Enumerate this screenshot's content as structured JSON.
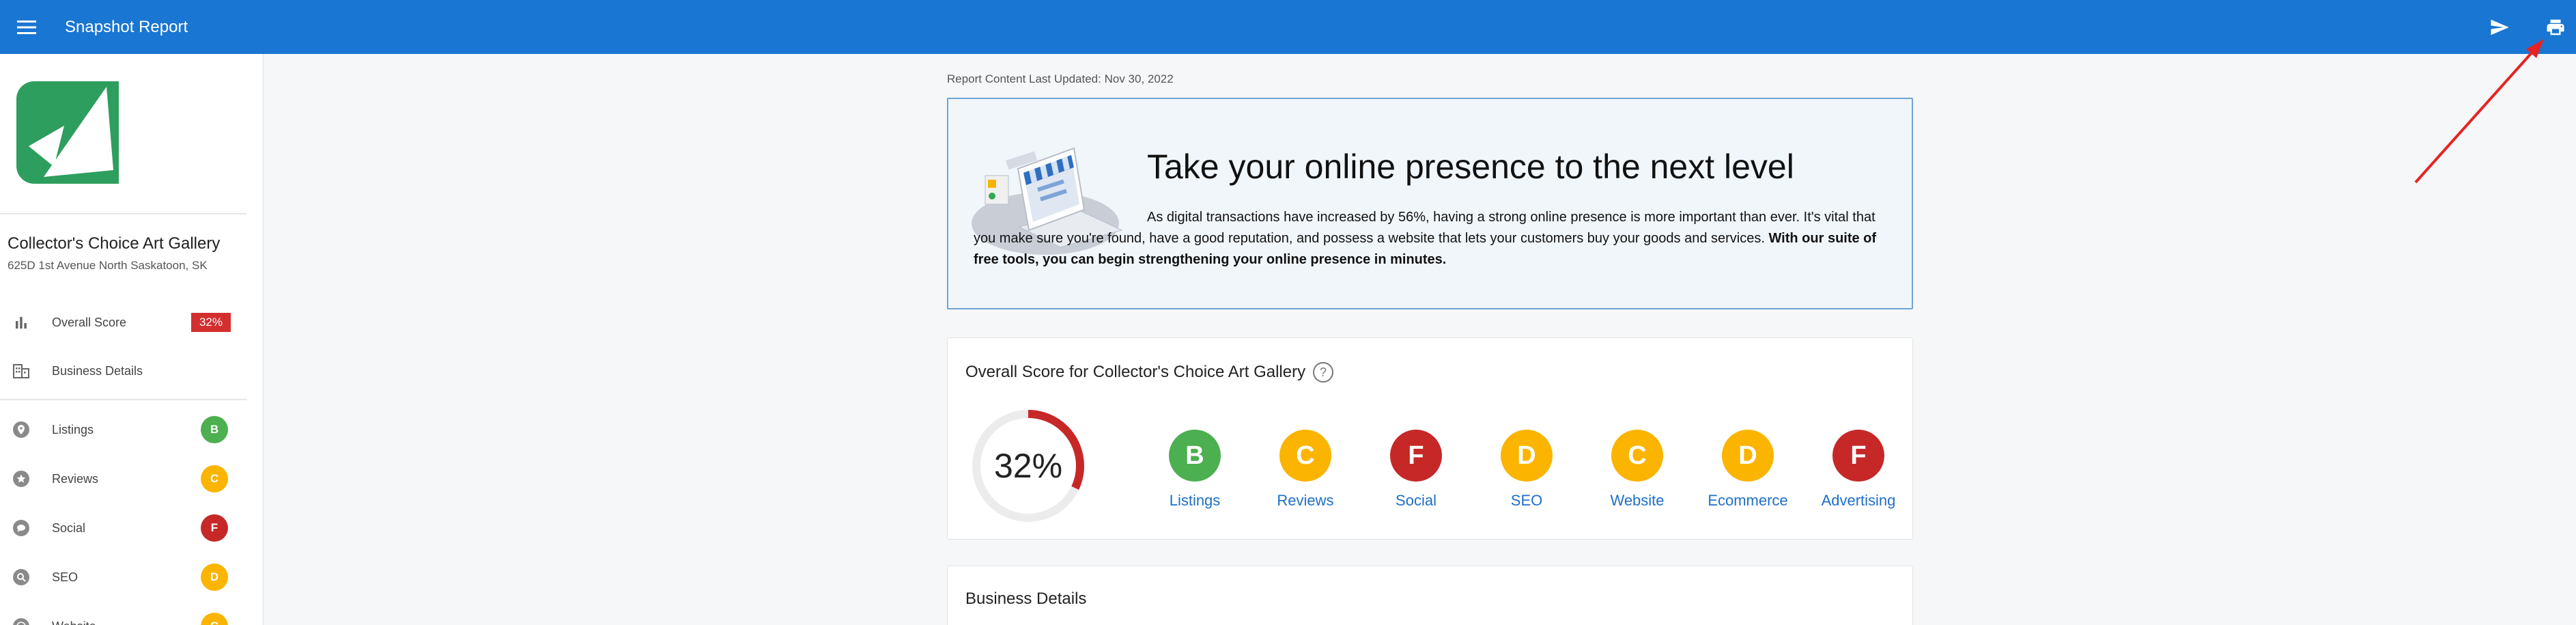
{
  "header": {
    "title": "Snapshot Report",
    "bg_color": "#1976d2"
  },
  "sidebar": {
    "business_name": "Collector's Choice Art Gallery",
    "business_address": "625D 1st Avenue North Saskatoon, SK",
    "items": [
      {
        "label": "Overall Score",
        "icon": "bar-chart-icon",
        "score": "32%"
      },
      {
        "label": "Business Details",
        "icon": "building-icon"
      },
      {
        "label": "Listings",
        "icon": "location-pin-icon",
        "grade": "B"
      },
      {
        "label": "Reviews",
        "icon": "star-icon",
        "grade": "C"
      },
      {
        "label": "Social",
        "icon": "chat-bubble-icon",
        "grade": "F"
      },
      {
        "label": "SEO",
        "icon": "search-icon",
        "grade": "D"
      },
      {
        "label": "Website",
        "icon": "globe-icon",
        "grade": "C"
      }
    ]
  },
  "main": {
    "last_updated": "Report Content Last Updated:  Nov 30, 2022",
    "promo": {
      "title": "Take your online presence to the next level",
      "body": "As digital transactions have increased by 56%, having a strong online presence is more important than ever. It's vital that you make sure you're found, have a good reputation, and possess a website that lets your customers buy your goods and services. ",
      "body_bold": "With our suite of free tools, you can begin strengthening your online presence in minutes."
    },
    "overall": {
      "title": "Overall Score for Collector's Choice Art Gallery",
      "percent_label": "32%",
      "percent_value": 32,
      "grades": [
        {
          "letter": "B",
          "label": "Listings",
          "color": "#4caf50"
        },
        {
          "letter": "C",
          "label": "Reviews",
          "color": "#fbb400"
        },
        {
          "letter": "F",
          "label": "Social",
          "color": "#c62828"
        },
        {
          "letter": "D",
          "label": "SEO",
          "color": "#fbb400"
        },
        {
          "letter": "C",
          "label": "Website",
          "color": "#fbb400"
        },
        {
          "letter": "D",
          "label": "Ecommerce",
          "color": "#fbb400"
        },
        {
          "letter": "F",
          "label": "Advertising",
          "color": "#c62828"
        }
      ]
    },
    "details_title": "Business Details"
  },
  "colors": {
    "grade_B": "#4caf50",
    "grade_C": "#fbb400",
    "grade_D": "#fbb400",
    "grade_F": "#c62828",
    "score_chip": "#d32f2f",
    "accent": "#1976d2"
  }
}
